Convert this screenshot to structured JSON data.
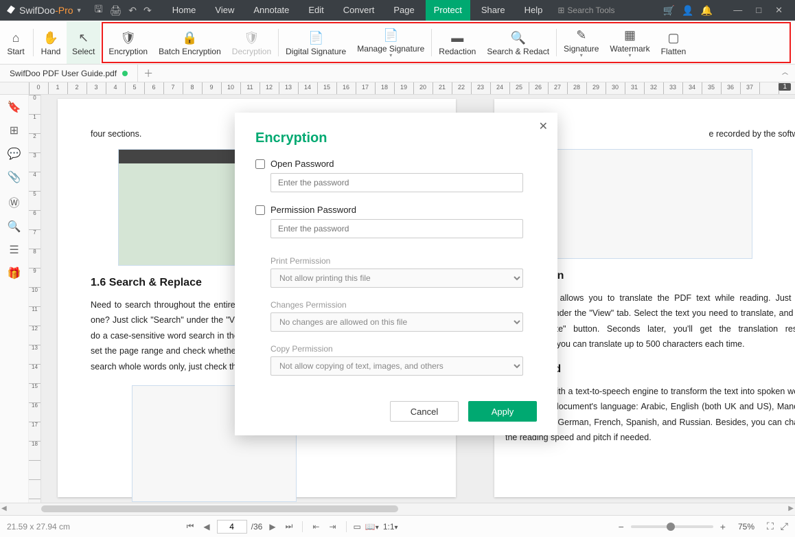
{
  "titlebar": {
    "app_a": "SwifDoo",
    "app_b": "-Pro",
    "search_placeholder": "Search Tools"
  },
  "menus": [
    "Home",
    "View",
    "Annotate",
    "Edit",
    "Convert",
    "Page",
    "Protect",
    "Share",
    "Help"
  ],
  "menu_active": "Protect",
  "ribbon": {
    "start": "Start",
    "hand": "Hand",
    "select": "Select",
    "items": [
      "Encryption",
      "Batch Encryption",
      "Decryption",
      "Digital Signature",
      "Manage Signature",
      "Redaction",
      "Search & Redact",
      "Signature",
      "Watermark",
      "Flatten"
    ]
  },
  "tab": {
    "name": "SwifDoo PDF User Guide.pdf"
  },
  "hruler_page": "1",
  "hruler": [
    "0",
    "1",
    "2",
    "3",
    "4",
    "5",
    "6",
    "7",
    "8",
    "9",
    "10",
    "11",
    "12",
    "13",
    "14",
    "15",
    "16",
    "17",
    "18",
    "19",
    "20",
    "21",
    "22",
    "23",
    "24",
    "25",
    "26",
    "27",
    "28",
    "29",
    "30",
    "31",
    "32",
    "33",
    "34",
    "35",
    "36",
    "37"
  ],
  "vruler": [
    "0",
    "1",
    "2",
    "3",
    "4",
    "5",
    "6",
    "7",
    "8",
    "9",
    "10",
    "11",
    "12",
    "13",
    "14",
    "15",
    "16",
    "17",
    "18"
  ],
  "doc": {
    "p1_top": "four sections.",
    "p1_h": "1.6 Search & Replace",
    "p1_body": "Need to search throughout the entire PDF document, or replace a word with another one? Just click \"Search\" under the \"View\" tab to find the word you want. If you want to do a case-sensitive word search in the PDF document, the software also allows you to set the page range and check whether the keywords are case-sensitive. If you need to search whole words only, just check the box.",
    "p2_top": "e recorded by the software.",
    "p2_h1": "Translation",
    "p2_b1": "slate feature allows you to translate the PDF text while reading. Just click \"Translate\" under the \"View\" tab. Select the text you need to translate, and click the \"Translate\" button. Seconds later, you'll get the translation results. Noteworthily, you can translate up to 500 characters each time.",
    "p2_h2": "PDF Aloud",
    "p2_b2": "s equipped with a text-to-speech engine to transform the text into spoken words. Besides the document's language: Arabic, English (both UK and US), Mandarin (Putonghua), German, French, Spanish, and Russian. Besides, you can change the reading speed and pitch if needed."
  },
  "dialog": {
    "title": "Encryption",
    "open_pw": "Open Password",
    "perm_pw": "Permission Password",
    "pw_ph": "Enter the password",
    "print_label": "Print Permission",
    "print_val": "Not allow printing this file",
    "changes_label": "Changes Permission",
    "changes_val": "No changes are allowed on this file",
    "copy_label": "Copy Permission",
    "copy_val": "Not allow copying of text, images, and others",
    "cancel": "Cancel",
    "apply": "Apply"
  },
  "status": {
    "coords": "21.59 x 27.94 cm",
    "page": "4",
    "total": "/36",
    "zoom": "75%"
  }
}
